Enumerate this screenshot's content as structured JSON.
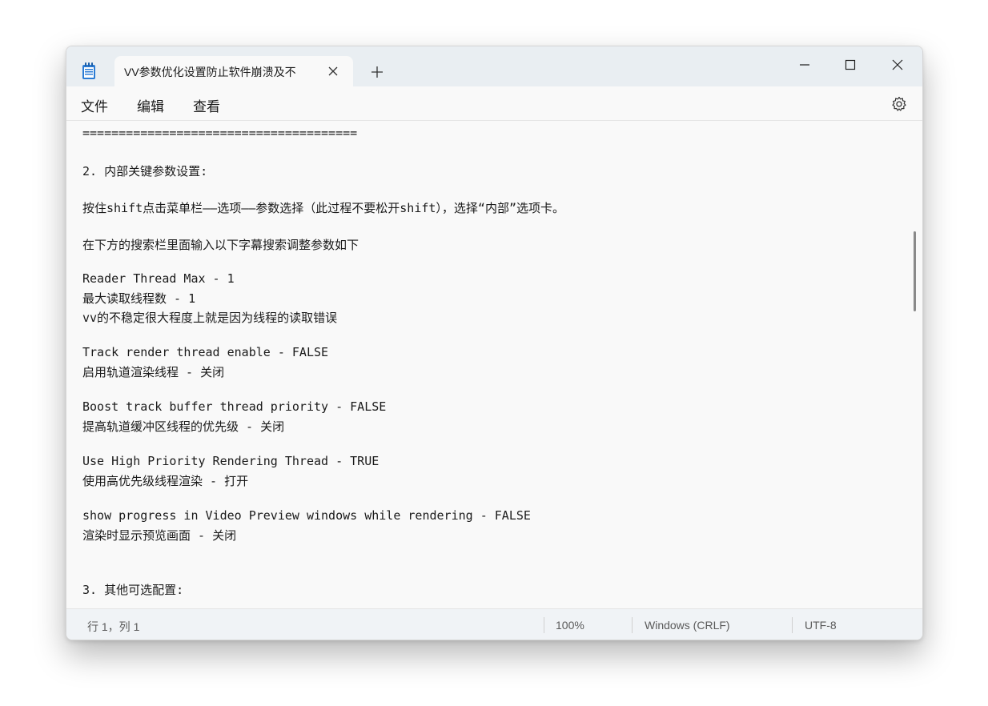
{
  "tab": {
    "title": "VV参数优化设置防止软件崩溃及不",
    "close_glyph": "✕",
    "new_glyph": "+"
  },
  "menu": {
    "file": "文件",
    "edit": "编辑",
    "view": "查看"
  },
  "content": {
    "lines": [
      "======================================",
      "2. 内部关键参数设置:",
      "按住shift点击菜单栏——选项——参数选择（此过程不要松开shift），选择“内部”选项卡。",
      "在下方的搜索栏里面输入以下字幕搜索调整参数如下",
      "Reader Thread Max - 1",
      "最大读取线程数 - 1",
      "vv的不稳定很大程度上就是因为线程的读取错误",
      "Track render thread enable - FALSE",
      "启用轨道渲染线程 - 关闭",
      "Boost track buffer thread priority - FALSE",
      "提高轨道缓冲区线程的优先级 - 关闭",
      "Use High Priority Rendering Thread - TRUE",
      "使用高优先级线程渲染 - 打开",
      "show progress in Video Preview windows while rendering - FALSE",
      "渲染时显示预览画面 - 关闭",
      "3. 其他可选配置:"
    ]
  },
  "status": {
    "position": "行 1，列 1",
    "zoom": "100%",
    "line_ending": "Windows (CRLF)",
    "encoding": "UTF-8"
  },
  "icons": {
    "app": "notepad-icon",
    "settings": "gear-icon",
    "minimize": "minimize-icon",
    "maximize": "maximize-icon",
    "close": "close-icon"
  },
  "colors": {
    "titlebar": "#e9eef2",
    "editor_bg": "#f9f9f9",
    "text": "#1a1a1a",
    "app_icon": "#2b7bd4"
  }
}
